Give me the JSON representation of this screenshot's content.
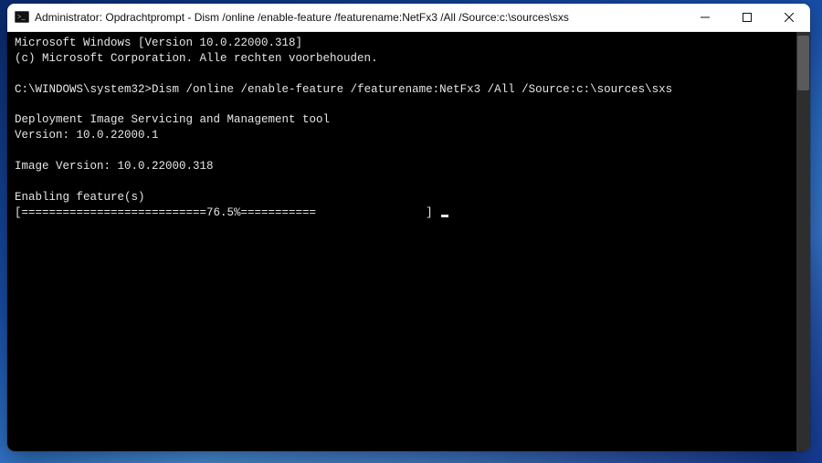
{
  "window": {
    "title": "Administrator: Opdrachtprompt - Dism  /online /enable-feature /featurename:NetFx3 /All /Source:c:\\sources\\sxs",
    "icon": "cmd-icon"
  },
  "terminal": {
    "line1": "Microsoft Windows [Version 10.0.22000.318]",
    "line2": "(c) Microsoft Corporation. Alle rechten voorbehouden.",
    "blank1": "",
    "prompt": "C:\\WINDOWS\\system32>",
    "command": "Dism /online /enable-feature /featurename:NetFx3 /All /Source:c:\\sources\\sxs",
    "blank2": "",
    "tool1": "Deployment Image Servicing and Management tool",
    "tool2": "Version: 10.0.22000.1",
    "blank3": "",
    "imgver": "Image Version: 10.0.22000.318",
    "blank4": "",
    "enabling": "Enabling feature(s)",
    "progress": "[===========================76.5%===========                ] "
  }
}
